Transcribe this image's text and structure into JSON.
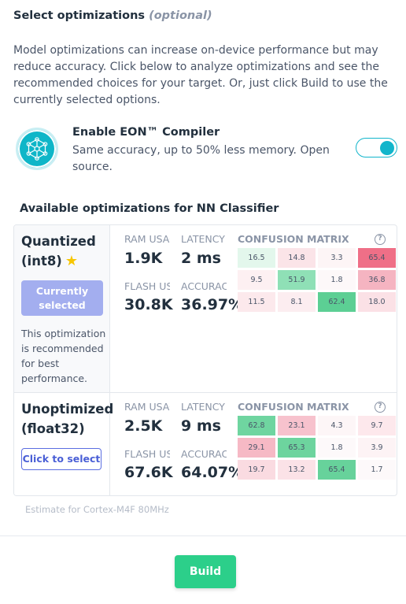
{
  "section": {
    "title": "Select optimizations",
    "optional_label": "(optional)",
    "intro": "Model optimizations can increase on-device performance but may reduce accuracy. Click below to analyze optimizations and see the recommended choices for your target. Or, just click Build to use the currently selected options."
  },
  "eon": {
    "title": "Enable EON™ Compiler",
    "description": "Same accuracy, up to 50% less memory. Open source.",
    "enabled": true,
    "logo_icon": "eon-network-icon",
    "accent_color": "#12b5cb"
  },
  "available": {
    "title": "Available optimizations for NN Classifier"
  },
  "labels": {
    "ram": "RAM USAGE",
    "latency": "LATENCY",
    "flash": "FLASH USAGE",
    "accuracy": "ACCURACY",
    "confusion": "CONFUSION MATRIX",
    "help_glyph": "?"
  },
  "optimizations": [
    {
      "name_line1": "Quantized",
      "name_line2": "(int8)",
      "star_icon": "star-icon",
      "star_glyph": "★",
      "button_label": "Currently selected",
      "note": "This optimization is recommended for best performance.",
      "ram": "1.9K",
      "latency": "2 ms",
      "flash": "30.8K",
      "accuracy": "36.97%",
      "matrix": [
        [
          "16.5",
          "14.8",
          "3.3",
          "65.4"
        ],
        [
          "9.5",
          "51.9",
          "1.8",
          "36.8"
        ],
        [
          "11.5",
          "8.1",
          "62.4",
          "18.0"
        ]
      ],
      "matrix_colors": [
        [
          "#e3f7ec",
          "#fbe4e8",
          "#fdf5f6",
          "#ef6f87"
        ],
        [
          "#fdf0f2",
          "#8fe0b6",
          "#fdf8f9",
          "#f5b4c1"
        ],
        [
          "#fce9ec",
          "#fcedf0",
          "#5ccf94",
          "#fbe1e6"
        ]
      ]
    },
    {
      "name_line1": "Unoptimized",
      "name_line2": "(float32)",
      "button_label": "Click to select",
      "ram": "2.5K",
      "latency": "9 ms",
      "flash": "67.6K",
      "accuracy": "64.07%",
      "matrix": [
        [
          "62.8",
          "23.1",
          "4.3",
          "9.7"
        ],
        [
          "29.1",
          "65.3",
          "1.8",
          "3.9"
        ],
        [
          "19.7",
          "13.2",
          "65.4",
          "1.7"
        ]
      ],
      "matrix_colors": [
        [
          "#6fd5a0",
          "#f7c2cd",
          "#fdf6f7",
          "#fde8ec"
        ],
        [
          "#f6b9c5",
          "#6dd49e",
          "#fdf9fa",
          "#fdf3f5"
        ],
        [
          "#fadbe1",
          "#fbe2e7",
          "#67d29b",
          "#fdf9fa"
        ]
      ]
    }
  ],
  "estimate": "Estimate for Cortex-M4F 80MHz",
  "build_label": "Build",
  "colors": {
    "selected_button": "#a3aeef",
    "select_button": "#4a5fd6",
    "build_button": "#2ccf8a",
    "star": "#f7c600"
  }
}
